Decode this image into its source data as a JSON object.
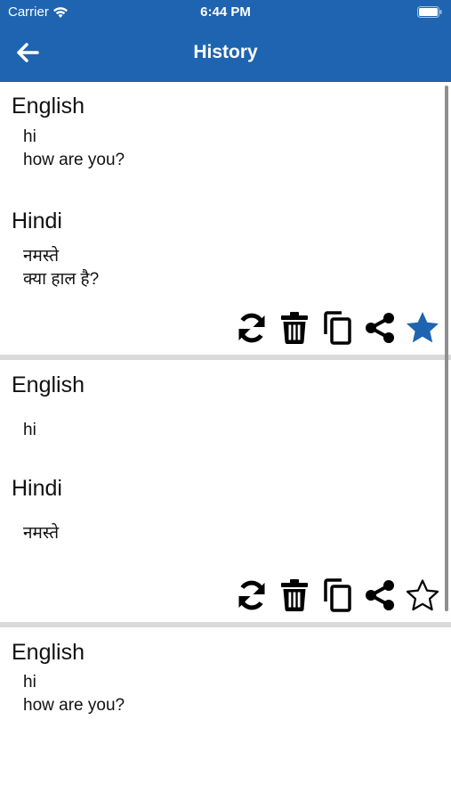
{
  "status": {
    "carrier": "Carrier",
    "time": "6:44 PM"
  },
  "header": {
    "title": "History"
  },
  "colors": {
    "accent": "#1e64b0",
    "divider": "#d9d9d9"
  },
  "history": [
    {
      "source_lang": "English",
      "source_lines": [
        "hi",
        "how are you?"
      ],
      "target_lang": "Hindi",
      "target_lines": [
        "नमस्ते",
        "क्या हाल है?"
      ],
      "favorite": true
    },
    {
      "source_lang": "English",
      "source_lines": [
        "hi"
      ],
      "target_lang": "Hindi",
      "target_lines": [
        "नमस्ते"
      ],
      "favorite": false
    },
    {
      "source_lang": "English",
      "source_lines": [
        "hi",
        "how are you?"
      ]
    }
  ]
}
